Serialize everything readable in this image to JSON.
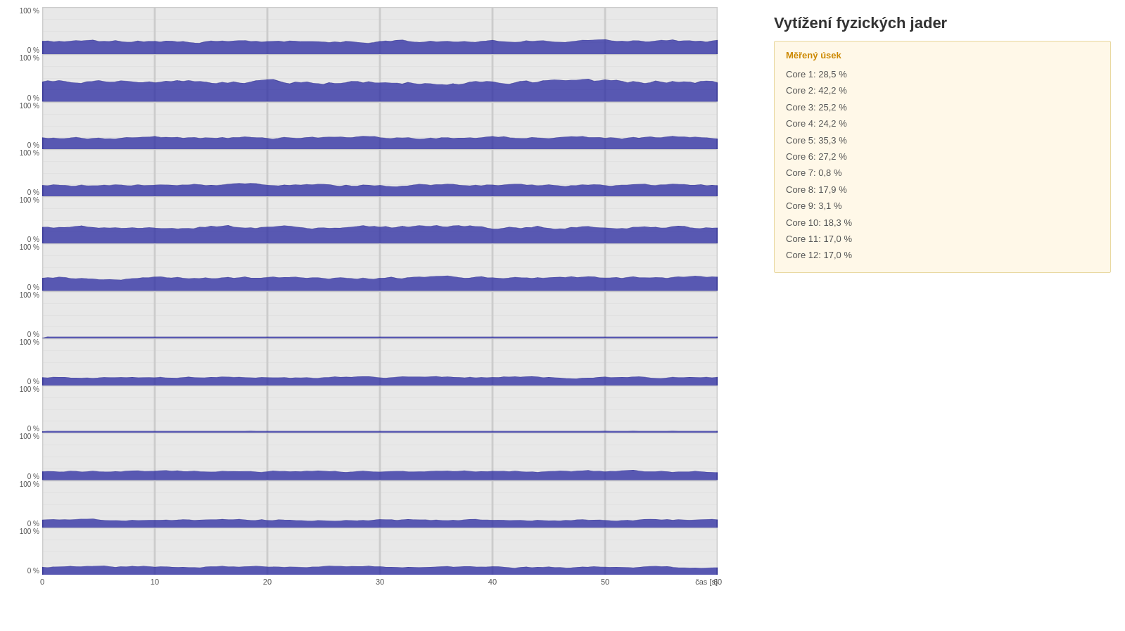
{
  "title": "Vytížení fyzických jader",
  "panel": {
    "subtitle": "Měřený úsek",
    "cores": [
      {
        "label": "Core  1:",
        "value": "28,5 %"
      },
      {
        "label": "Core  2:",
        "value": "42,2 %"
      },
      {
        "label": "Core  3:",
        "value": "25,2 %"
      },
      {
        "label": "Core  4:",
        "value": "24,2 %"
      },
      {
        "label": "Core  5:",
        "value": "35,3 %"
      },
      {
        "label": "Core  6:",
        "value": "27,2 %"
      },
      {
        "label": "Core  7:",
        "value": "0,8 %"
      },
      {
        "label": "Core  8:",
        "value": "17,9 %"
      },
      {
        "label": "Core  9:",
        "value": "3,1 %"
      },
      {
        "label": "Core 10:",
        "value": "18,3 %"
      },
      {
        "label": "Core 11:",
        "value": "17,0 %"
      },
      {
        "label": "Core 12:",
        "value": "17,0 %"
      }
    ]
  },
  "xaxis": {
    "label": "čas [s]",
    "ticks": [
      "0",
      "10",
      "20",
      "30",
      "40",
      "50",
      "60"
    ]
  },
  "ylabel_100": "100 %",
  "ylabel_0": "0 %",
  "core_usage_percent": [
    28.5,
    42.2,
    25.2,
    24.2,
    35.3,
    27.2,
    0.8,
    17.9,
    3.1,
    18.3,
    17.0,
    17.0
  ]
}
